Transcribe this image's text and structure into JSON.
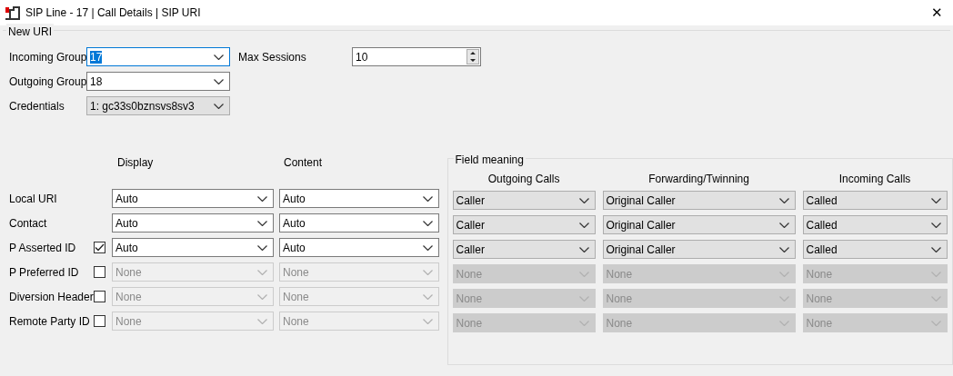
{
  "window": {
    "title": "SIP Line - 17 | Call Details | SIP URI",
    "close": "✕"
  },
  "new_uri": {
    "title": "New URI",
    "fields": [
      {
        "label": "Incoming Group",
        "value": "17",
        "kind": "editable",
        "focused": true
      },
      {
        "label": "Outgoing Group",
        "value": "18",
        "kind": "editable",
        "focused": false
      },
      {
        "label": "Credentials",
        "value": "1: gc33s0bznsvs8sv3",
        "kind": "list",
        "focused": false
      }
    ],
    "max_sessions": {
      "label": "Max Sessions",
      "value": "10"
    }
  },
  "uri_table": {
    "columns": [
      "Display",
      "Content"
    ],
    "rows": [
      {
        "label": "Local URI",
        "kind": "plain",
        "display": "Auto",
        "content": "Auto",
        "disabled": false
      },
      {
        "label": "Contact",
        "kind": "plain",
        "display": "Auto",
        "content": "Auto",
        "disabled": false
      },
      {
        "label": "P Asserted ID",
        "kind": "checkbox",
        "checked": true,
        "display": "Auto",
        "content": "Auto",
        "disabled": false
      },
      {
        "label": "P Preferred  ID",
        "kind": "checkbox",
        "checked": false,
        "display": "None",
        "content": "None",
        "disabled": true
      },
      {
        "label": "Diversion Header",
        "kind": "checkbox",
        "checked": false,
        "display": "None",
        "content": "None",
        "disabled": true
      },
      {
        "label": "Remote Party ID",
        "kind": "checkbox",
        "checked": false,
        "display": "None",
        "content": "None",
        "disabled": true
      }
    ]
  },
  "field_meaning": {
    "title": "Field meaning",
    "columns": [
      "Outgoing Calls",
      "Forwarding/Twinning",
      "Incoming Calls"
    ],
    "rows": [
      {
        "values": [
          "Caller",
          "Original Caller",
          "Called"
        ],
        "disabled": false
      },
      {
        "values": [
          "Caller",
          "Original Caller",
          "Called"
        ],
        "disabled": false
      },
      {
        "values": [
          "Caller",
          "Original Caller",
          "Called"
        ],
        "disabled": false
      },
      {
        "values": [
          "None",
          "None",
          "None"
        ],
        "disabled": true
      },
      {
        "values": [
          "None",
          "None",
          "None"
        ],
        "disabled": true
      },
      {
        "values": [
          "None",
          "None",
          "None"
        ],
        "disabled": true
      }
    ]
  }
}
